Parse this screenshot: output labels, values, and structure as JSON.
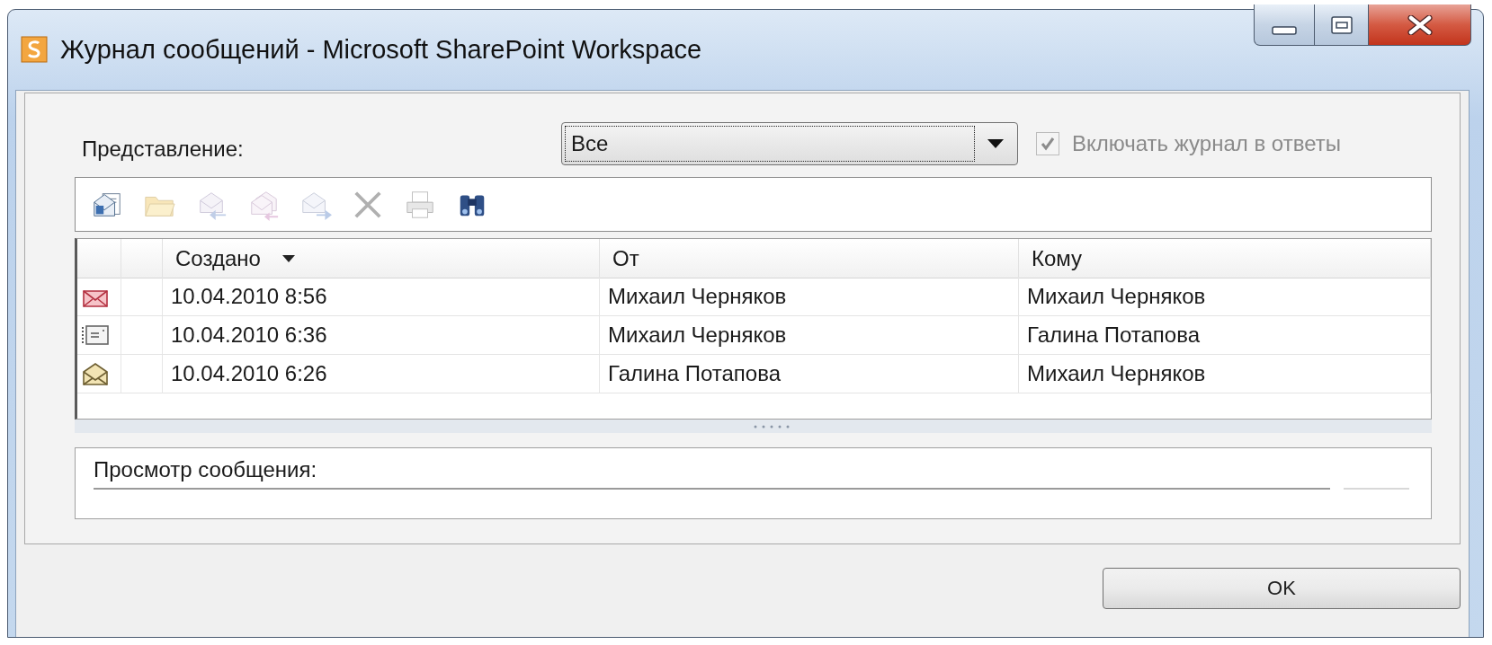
{
  "window": {
    "title": "Журнал сообщений - Microsoft SharePoint Workspace"
  },
  "view": {
    "label": "Представление:",
    "value": "Все"
  },
  "include_history": {
    "label": "Включать журнал в ответы",
    "checked": true,
    "disabled": true
  },
  "toolbar": [
    {
      "kind": "new",
      "disabled": false
    },
    {
      "kind": "open",
      "disabled": true
    },
    {
      "kind": "reply",
      "disabled": true
    },
    {
      "kind": "reply-all",
      "disabled": true
    },
    {
      "kind": "forward",
      "disabled": true
    },
    {
      "kind": "delete",
      "disabled": true
    },
    {
      "kind": "print",
      "disabled": true
    },
    {
      "kind": "find",
      "disabled": false
    }
  ],
  "table": {
    "columns": [
      {
        "label": "Создано",
        "sorted": true
      },
      {
        "label": "От",
        "sorted": false
      },
      {
        "label": "Кому",
        "sorted": false
      }
    ],
    "rows": [
      {
        "kind": "unread",
        "cells": [
          "10.04.2010 8:56",
          "Михаил Черняков",
          "Михаил Черняков"
        ]
      },
      {
        "kind": "invitation",
        "cells": [
          "10.04.2010 6:36",
          "Михаил Черняков",
          "Галина Потапова"
        ]
      },
      {
        "kind": "read",
        "cells": [
          "10.04.2010 6:26",
          "Галина Потапова",
          "Михаил Черняков"
        ]
      }
    ]
  },
  "preview": {
    "label": "Просмотр сообщения:"
  },
  "buttons": [
    "OK"
  ]
}
